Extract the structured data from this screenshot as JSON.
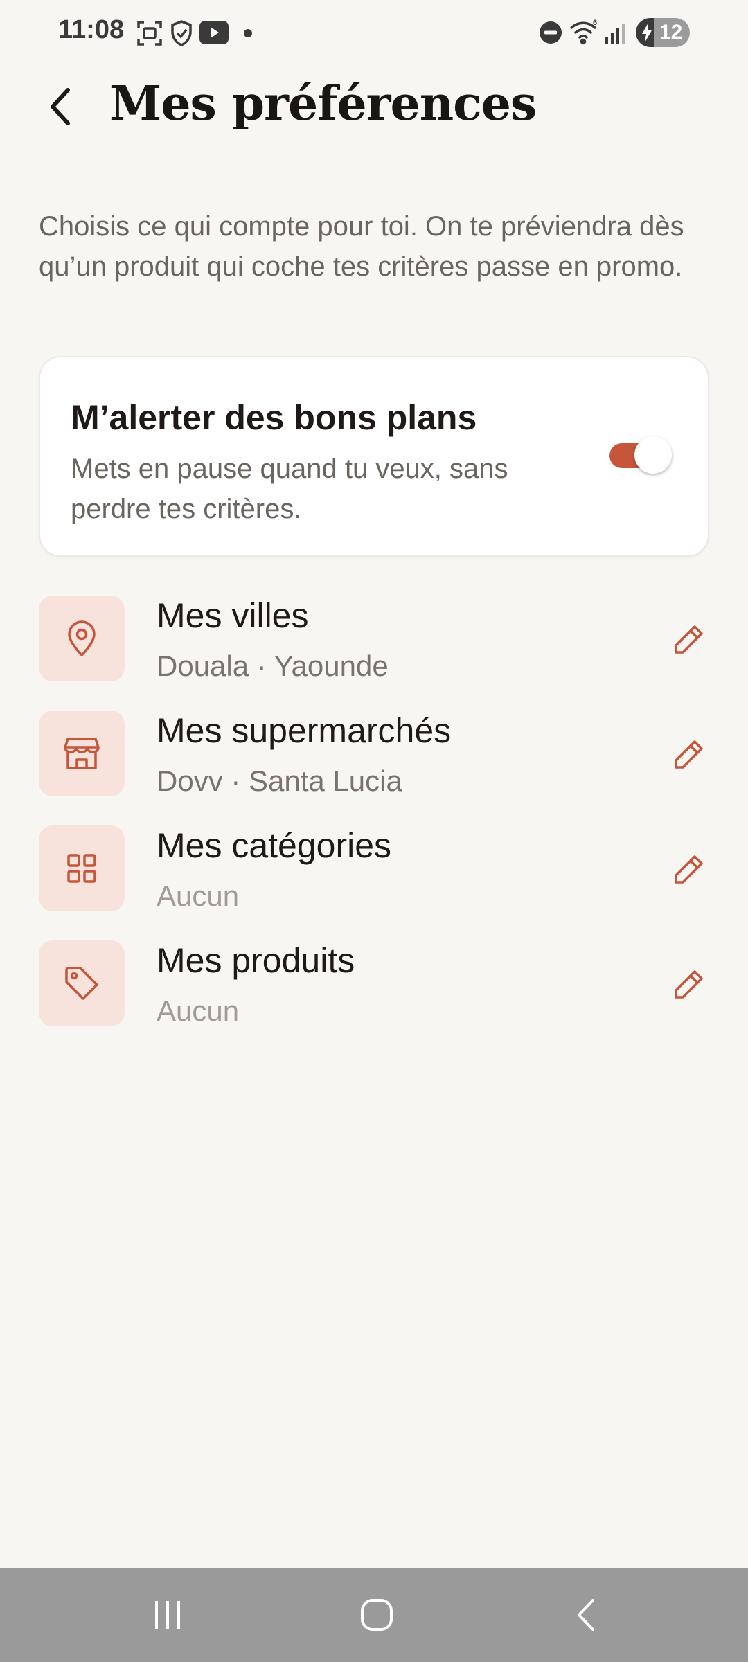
{
  "status_bar": {
    "time": "11:08",
    "battery": "12",
    "icons": [
      "screenshot-icon",
      "shield-icon",
      "youtube-icon",
      "notification-dot",
      "do-not-disturb-icon",
      "wifi-icon",
      "signal-icon",
      "battery-icon"
    ]
  },
  "header": {
    "title": "Mes préférences",
    "back_icon": "chevron-left-icon"
  },
  "intro": "Choisis ce qui compte pour toi. On te préviendra dès qu’un produit qui coche tes critères passe en promo.",
  "alert": {
    "title": "M’alerter des bons plans",
    "description": "Mets en pause quand tu veux, sans perdre tes critères.",
    "enabled": true
  },
  "preferences": [
    {
      "title": "Mes villes",
      "value": "Douala · Yaounde",
      "icon": "location-pin-icon"
    },
    {
      "title": "Mes supermarchés",
      "value": "Dovv · Santa Lucia",
      "icon": "store-icon"
    },
    {
      "title": "Mes catégories",
      "value": "Aucun",
      "icon": "grid-icon"
    },
    {
      "title": "Mes produits",
      "value": "Aucun",
      "icon": "tag-icon"
    }
  ],
  "colors": {
    "background": "#f8f6f3",
    "accent": "#c6553a",
    "icon_bg": "#f8e3dc",
    "nav_bar": "#9a9a9a"
  },
  "nav_bar": {
    "buttons": [
      "recent-apps-icon",
      "home-icon",
      "back-icon"
    ]
  }
}
